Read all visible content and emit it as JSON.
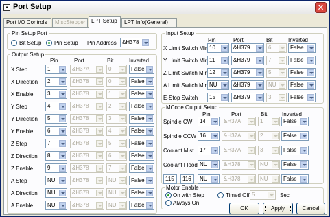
{
  "window": {
    "title": "Port Setup"
  },
  "tabs": [
    "Port I/O Controls",
    "MiscStepper",
    "LPT Setup",
    "LPT Info(General)"
  ],
  "pin_setup_port": {
    "legend": "Pin Setup Port",
    "bit_setup": "Bit Setup",
    "pin_setup": "Pin Setup",
    "pin_address_label": "Pin Address",
    "pin_address_value": "&H378"
  },
  "output_setup": {
    "legend": "Output Setup",
    "headers": {
      "pin": "Pin",
      "port": "Port",
      "bit": "Bit",
      "inverted": "Inverted"
    },
    "rows": [
      {
        "label": "X Step",
        "pin": "1",
        "port": "&H37A",
        "bit": "0",
        "inverted": "False"
      },
      {
        "label": "X Direction",
        "pin": "2",
        "port": "&H378",
        "bit": "0",
        "inverted": "False"
      },
      {
        "label": "X Enable",
        "pin": "3",
        "port": "&H378",
        "bit": "1",
        "inverted": "False"
      },
      {
        "label": "Y Step",
        "pin": "4",
        "port": "&H378",
        "bit": "2",
        "inverted": "False"
      },
      {
        "label": "Y Direction",
        "pin": "5",
        "port": "&H378",
        "bit": "3",
        "inverted": "False"
      },
      {
        "label": "Y Enable",
        "pin": "6",
        "port": "&H378",
        "bit": "4",
        "inverted": "False"
      },
      {
        "label": "Z Step",
        "pin": "7",
        "port": "&H378",
        "bit": "5",
        "inverted": "False"
      },
      {
        "label": "Z Direction",
        "pin": "8",
        "port": "&H378",
        "bit": "6",
        "inverted": "False"
      },
      {
        "label": "Z Enable",
        "pin": "9",
        "port": "&H378",
        "bit": "7",
        "inverted": "False"
      },
      {
        "label": "A Step",
        "pin": "NU",
        "port": "&H378",
        "bit": "NU",
        "inverted": "False"
      },
      {
        "label": "A Direction",
        "pin": "NU",
        "port": "&H378",
        "bit": "NU",
        "inverted": "False"
      },
      {
        "label": "A Enable",
        "pin": "NU",
        "port": "&H378",
        "bit": "NU",
        "inverted": "False"
      }
    ]
  },
  "input_setup": {
    "legend": "Input Setup",
    "headers": {
      "pin": "Pin",
      "port": "Port",
      "bit": "Bit",
      "inverted": "Inverted"
    },
    "rows": [
      {
        "label": "X Limit Switch Min",
        "pin": "10",
        "port": "&H379",
        "bit": "6",
        "inverted": "False"
      },
      {
        "label": "Y Limit Switch Min",
        "pin": "11",
        "port": "&H379",
        "bit": "7",
        "inverted": "False"
      },
      {
        "label": "Z Limit Switch Min",
        "pin": "12",
        "port": "&H379",
        "bit": "5",
        "inverted": "False"
      },
      {
        "label": "A Limit Switch Min",
        "pin": "NU",
        "port": "&H379",
        "bit": "NU",
        "inverted": "False"
      },
      {
        "label": "E-Stop Switch",
        "pin": "15",
        "port": "&H379",
        "bit": "3",
        "inverted": "False"
      }
    ]
  },
  "mcode_output_setup": {
    "legend": "MCode Output Setup",
    "headers": {
      "pin": "Pin",
      "port": "Port",
      "bit": "Bit",
      "inverted": "Inverted"
    },
    "rows": [
      {
        "label": "Spindle CW",
        "pin": "14",
        "port": "&H37A",
        "bit": "1",
        "inverted": "False"
      },
      {
        "label": "Spindle CCW",
        "pin": "16",
        "port": "&H37A",
        "bit": "2",
        "inverted": "False"
      },
      {
        "label": "Coolant Mist",
        "pin": "17",
        "port": "&H37A",
        "bit": "3",
        "inverted": "False"
      },
      {
        "label": "Coolant Flood",
        "pin": "NU",
        "port": "&H378",
        "bit": "NU",
        "inverted": "False"
      }
    ],
    "custom_row": {
      "code_a": "115",
      "code_b": "116",
      "pin": "NU",
      "port": "&H378",
      "bit": "NU",
      "inverted": "False"
    }
  },
  "motor_enable": {
    "legend": "Motor Enable",
    "on_with_step": "On with Step",
    "timed_off": "Timed Off",
    "timed_value": "5",
    "sec": "Sec",
    "always_on": "Always On"
  },
  "buttons": {
    "ok": "OK",
    "apply": "Apply",
    "cancel": "Cancel"
  }
}
